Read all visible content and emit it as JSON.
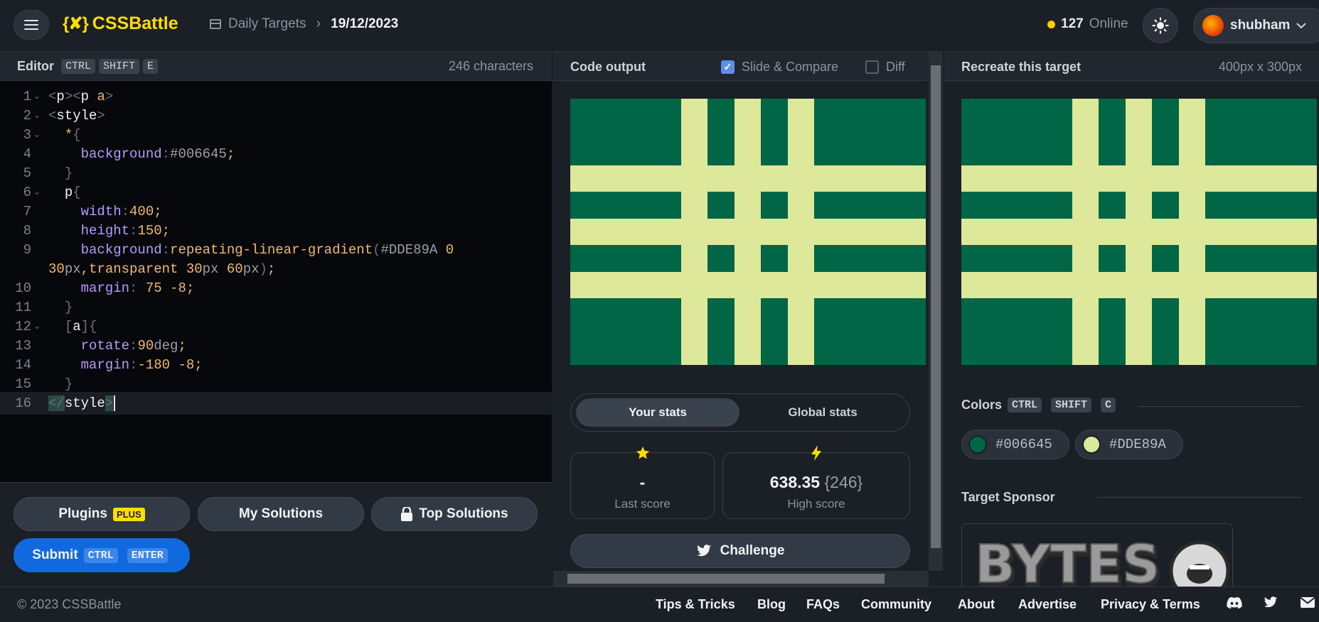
{
  "header": {
    "brand": "CSSBattle",
    "brand_mark": "{✘}",
    "breadcrumb": [
      "Daily Targets",
      "19/12/2023"
    ],
    "online_count": "127",
    "online_label": "Online",
    "username": "shubham"
  },
  "editor": {
    "title": "Editor",
    "shortcut": [
      "CTRL",
      "SHIFT",
      "E"
    ],
    "char_count": "246 characters",
    "line_numbers": [
      "1",
      "2",
      "3",
      "4",
      "5",
      "6",
      "7",
      "8",
      "9",
      "",
      "10",
      "11",
      "12",
      "13",
      "14",
      "15",
      "16"
    ]
  },
  "output": {
    "title": "Code output",
    "slide_compare_label": "Slide & Compare",
    "slide_compare_checked": true,
    "diff_label": "Diff",
    "diff_checked": false,
    "stats_tabs": [
      "Your stats",
      "Global stats"
    ],
    "last_score_value": "-",
    "last_score_label": "Last score",
    "high_score_value": "638.35",
    "high_score_chars": "{246}",
    "high_score_label": "High score",
    "challenge_label": "Challenge"
  },
  "actions": {
    "plugins_label": "Plugins",
    "plus_badge": "PLUS",
    "my_solutions_label": "My Solutions",
    "top_solutions_label": "Top Solutions",
    "submit_label": "Submit",
    "submit_shortcut": [
      "CTRL",
      "ENTER"
    ]
  },
  "target": {
    "title": "Recreate this target",
    "size": "400px x 300px",
    "colors_title": "Colors",
    "colors_shortcut": [
      "CTRL",
      "SHIFT",
      "C"
    ],
    "colors": [
      {
        "hex": "#006645",
        "label": "#006645"
      },
      {
        "hex": "#DDE89A",
        "label": "#DDE89A"
      }
    ],
    "sponsor_title": "Target Sponsor",
    "sponsor_logo_text": "BYTES"
  },
  "palette": {
    "bg": "#1b1f26",
    "panel": "#22272f",
    "accent_yellow": "#ffdd00",
    "submit_blue": "#1169e0",
    "art_green": "#006645",
    "art_yellow": "#DDE89A"
  },
  "footer": {
    "copyright": "© 2023 CSSBattle",
    "links": [
      "Tips & Tricks",
      "Blog",
      "FAQs",
      "Community",
      "About",
      "Advertise",
      "Privacy & Terms"
    ],
    "icons": [
      "discord-icon",
      "twitter-icon",
      "mail-icon"
    ]
  }
}
